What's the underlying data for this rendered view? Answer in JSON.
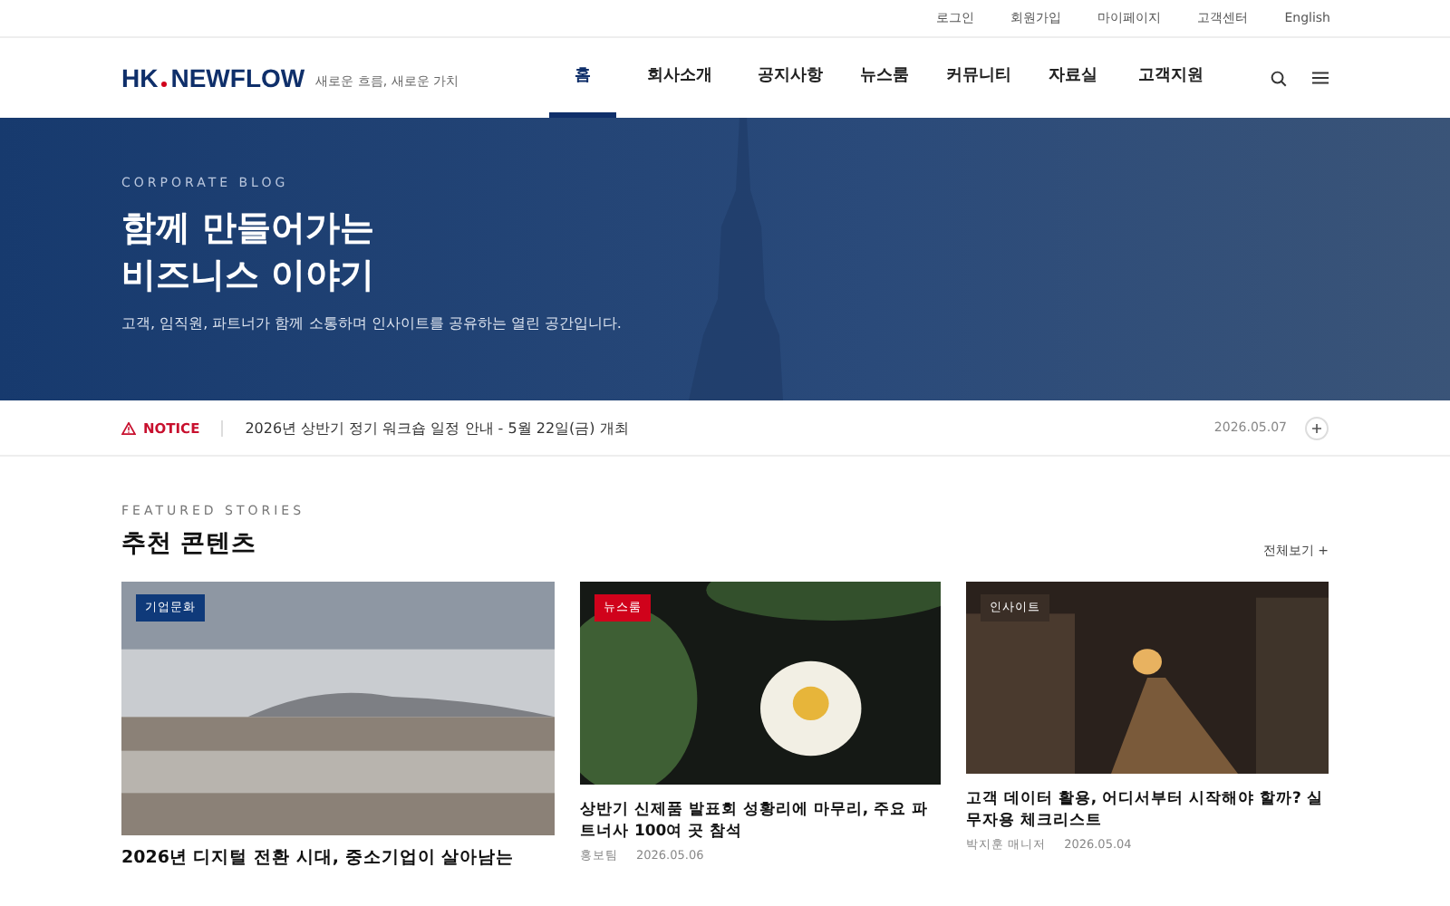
{
  "utility_links": [
    "로그인",
    "회원가입",
    "마이페이지",
    "고객센터",
    "English"
  ],
  "header": {
    "logo_left": "HK",
    "logo_right": "NEWFLOW",
    "tagline": "새로운 흐름, 새로운 가치"
  },
  "nav": [
    {
      "label": "홈",
      "selected": true
    },
    {
      "label": "회사소개",
      "selected": false
    },
    {
      "label": "공지사항",
      "selected": false
    },
    {
      "label": "뉴스룸",
      "selected": false
    },
    {
      "label": "커뮤니티",
      "selected": false
    },
    {
      "label": "자료실",
      "selected": false
    },
    {
      "label": "고객지원",
      "selected": false
    }
  ],
  "hero": {
    "eyebrow": "CORPORATE BLOG",
    "title_lines": [
      "함께 만들어가는",
      "비즈니스 이야기"
    ],
    "subtitle": "고객, 임직원, 파트너가 함께 소통하며 인사이트를 공유하는 열린 공간입니다."
  },
  "notice": {
    "label": "NOTICE",
    "text": "2026년 상반기 정기 워크숍 일정 안내 - 5월 22일(금) 개최",
    "date": "2026.05.07"
  },
  "featured": {
    "eyebrow": "FEATURED STORIES",
    "title": "추천 콘텐츠",
    "more": "전체보기 +",
    "cards": [
      {
        "tag": "기업문화",
        "color": "#0f3a7a",
        "title": "2026년 디지털 전환 시대, 중소기업이 살아남는",
        "kind": "beach"
      },
      {
        "tag": "뉴스룸",
        "color": "#d0021b",
        "title": "상반기 신제품 발표회 성황리에 마무리, 주요 파트너사 100여 곳 참석",
        "author": "홍보팀",
        "date": "2026.05.06",
        "kind": "flower"
      },
      {
        "tag": "인사이트",
        "color": "#3a2e26",
        "title": "고객 데이터 활용, 어디서부터 시작해야 할까? 실무자용 체크리스트",
        "author": "박지훈 매니저",
        "date": "2026.05.04",
        "kind": "street"
      }
    ]
  }
}
